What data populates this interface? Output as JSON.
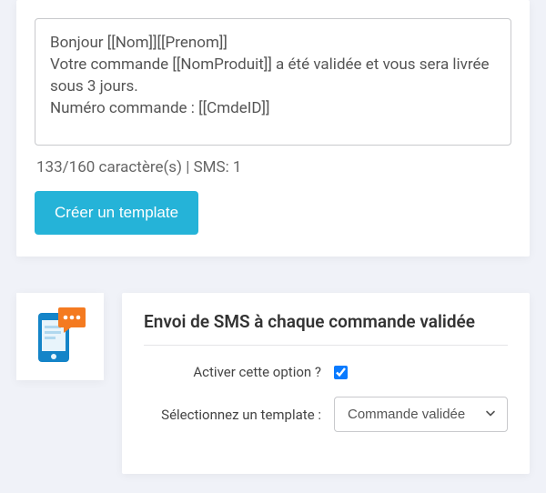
{
  "editor": {
    "content": "Bonjour [[Nom]][[Prenom]]\nVotre commande [[NomProduit]] a été validée et vous sera livrée sous 3 jours.\nNuméro commande : [[CmdeID]]",
    "counter": "133/160 caractère(s) | SMS: 1",
    "button_label": "Créer un template"
  },
  "settings": {
    "title": "Envoi de SMS à chaque commande validée",
    "enable_label": "Activer cette option ?",
    "enable_checked": true,
    "select_label": "Sélectionnez un template :",
    "select_value": "Commande validée"
  },
  "colors": {
    "accent": "#25b3d8",
    "phone": "#1484c8",
    "bubble": "#f47a20"
  }
}
